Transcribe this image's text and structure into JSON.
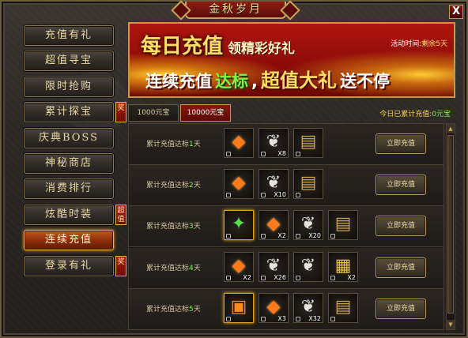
{
  "window": {
    "title": "金秋岁月",
    "close_label": "X"
  },
  "sidebar": {
    "items": [
      {
        "label": "充值有礼",
        "active": false,
        "badge": ""
      },
      {
        "label": "超值寻宝",
        "active": false,
        "badge": ""
      },
      {
        "label": "限时抢购",
        "active": false,
        "badge": ""
      },
      {
        "label": "累计探宝",
        "active": false,
        "badge": "奖"
      },
      {
        "label": "庆典BOSS",
        "active": false,
        "badge": ""
      },
      {
        "label": "神秘商店",
        "active": false,
        "badge": ""
      },
      {
        "label": "消费排行",
        "active": false,
        "badge": ""
      },
      {
        "label": "炫酷时装",
        "active": false,
        "badge": "超值"
      },
      {
        "label": "连续充值",
        "active": true,
        "badge": ""
      },
      {
        "label": "登录有礼",
        "active": false,
        "badge": "奖"
      }
    ]
  },
  "banner": {
    "big_text": "每日充值",
    "small_text": "领精彩好礼",
    "line2_a": "连续充值",
    "line2_b": "达标",
    "line2_c": "超值大礼",
    "line2_d": "送不停",
    "time_label": "活动时间:",
    "time_value": "剩余5天"
  },
  "tabs": [
    {
      "label": "1000元宝",
      "active": false
    },
    {
      "label": "10000元宝",
      "active": true
    }
  ],
  "daily_total": {
    "label": "今日已累计充值:",
    "value": "0元宝"
  },
  "rewards": [
    {
      "prefix": "累计充值达标",
      "day": "1",
      "suffix": "天",
      "button": "立即充值",
      "items": [
        {
          "icon": "ore-icon",
          "glyph": "◆",
          "cls": "g-ore",
          "qty": "",
          "highlight": false
        },
        {
          "icon": "feather-icon",
          "glyph": "❦",
          "cls": "g-feather",
          "qty": "X8",
          "highlight": false
        },
        {
          "icon": "scroll-icon",
          "glyph": "▤",
          "cls": "g-scroll",
          "qty": "",
          "highlight": false
        }
      ]
    },
    {
      "prefix": "累计充值达标",
      "day": "2",
      "suffix": "天",
      "button": "立即充值",
      "items": [
        {
          "icon": "ore-icon",
          "glyph": "◆",
          "cls": "g-ore",
          "qty": "",
          "highlight": false
        },
        {
          "icon": "feather-icon",
          "glyph": "❦",
          "cls": "g-feather",
          "qty": "X10",
          "highlight": false
        },
        {
          "icon": "scroll-icon",
          "glyph": "▤",
          "cls": "g-scroll",
          "qty": "",
          "highlight": false
        }
      ]
    },
    {
      "prefix": "累计充值达标",
      "day": "3",
      "suffix": "天",
      "button": "立即充值",
      "items": [
        {
          "icon": "gem-icon",
          "glyph": "✦",
          "cls": "g-gem",
          "qty": "",
          "highlight": true
        },
        {
          "icon": "ore-icon",
          "glyph": "◆",
          "cls": "g-ore",
          "qty": "X2",
          "highlight": false
        },
        {
          "icon": "feather-icon",
          "glyph": "❦",
          "cls": "g-feather",
          "qty": "X20",
          "highlight": false
        },
        {
          "icon": "scroll-icon",
          "glyph": "▤",
          "cls": "g-scroll",
          "qty": "",
          "highlight": false
        }
      ]
    },
    {
      "prefix": "累计充值达标",
      "day": "4",
      "suffix": "天",
      "button": "立即充值",
      "items": [
        {
          "icon": "ore-icon",
          "glyph": "◆",
          "cls": "g-ore",
          "qty": "X2",
          "highlight": false
        },
        {
          "icon": "feather-icon",
          "glyph": "❦",
          "cls": "g-feather",
          "qty": "X26",
          "highlight": false
        },
        {
          "icon": "feather-icon",
          "glyph": "❦",
          "cls": "g-feather",
          "qty": "",
          "highlight": false
        },
        {
          "icon": "book-icon",
          "glyph": "▦",
          "cls": "g-book",
          "qty": "X2",
          "highlight": false
        }
      ]
    },
    {
      "prefix": "累计充值达标",
      "day": "5",
      "suffix": "天",
      "button": "立即充值",
      "items": [
        {
          "icon": "chest-icon",
          "glyph": "▣",
          "cls": "g-chest",
          "qty": "",
          "highlight": true
        },
        {
          "icon": "ore-icon",
          "glyph": "◆",
          "cls": "g-ore",
          "qty": "X3",
          "highlight": false
        },
        {
          "icon": "feather-icon",
          "glyph": "❦",
          "cls": "g-feather",
          "qty": "X32",
          "highlight": false
        },
        {
          "icon": "scroll-icon",
          "glyph": "▤",
          "cls": "g-scroll",
          "qty": "",
          "highlight": false
        }
      ]
    }
  ]
}
